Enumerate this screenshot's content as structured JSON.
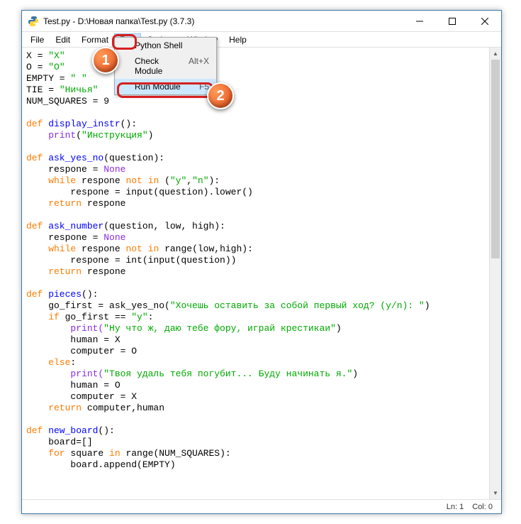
{
  "window": {
    "title": "Test.py - D:\\Новая папка\\Test.py (3.7.3)"
  },
  "menu": {
    "items": [
      "File",
      "Edit",
      "Format",
      "Run",
      "Options",
      "Window",
      "Help"
    ],
    "open_index": 3
  },
  "dropdown": {
    "items": [
      {
        "label": "Python Shell",
        "shortcut": ""
      },
      {
        "label": "Check Module",
        "shortcut": "Alt+X"
      },
      {
        "label": "Run Module",
        "shortcut": "F5"
      }
    ]
  },
  "badges": {
    "one": "1",
    "two": "2"
  },
  "status": {
    "line": "Ln: 1",
    "col": "Col: 0"
  },
  "code": {
    "l1a": "X = ",
    "l1b": "\"X\"",
    "l2a": "O = ",
    "l2b": "\"O\"",
    "l3a": "EMPTY = ",
    "l3b": "\" \"",
    "l4a": "TIE = ",
    "l4b": "\"Ничья\"",
    "l5a": "NUM_SQUARES = ",
    "l5b": "9",
    "l6": "",
    "l7a": "def",
    "l7b": " display_instr",
    "l7c": "():",
    "l8a": "    print",
    "l8b": "(",
    "l8c": "\"Инструкция\"",
    "l8d": ")",
    "l9": "",
    "l10a": "def",
    "l10b": " ask_yes_no",
    "l10c": "(question):",
    "l11a": "    respone = ",
    "l11b": "None",
    "l12a": "    while",
    "l12b": " respone ",
    "l12c": "not",
    "l12d": " ",
    "l12e": "in",
    "l12f": " (",
    "l12g": "\"y\"",
    "l12h": ",",
    "l12i": "\"n\"",
    "l12j": "):",
    "l13a": "        respone = input(question).lower()",
    "l14a": "    return",
    "l14b": " respone",
    "l15": "",
    "l16a": "def",
    "l16b": " ask_number",
    "l16c": "(question, low, high):",
    "l17a": "    respone = ",
    "l17b": "None",
    "l18a": "    while",
    "l18b": " respone ",
    "l18c": "not",
    "l18d": " ",
    "l18e": "in",
    "l18f": " range(low,high):",
    "l19a": "        respone = int(input(question))",
    "l20a": "    return",
    "l20b": " respone",
    "l21": "",
    "l22a": "def",
    "l22b": " pieces",
    "l22c": "():",
    "l23a": "    go_first = ask_yes_no(",
    "l23b": "\"Хочешь оставить за собой первый ход? (y/n): \"",
    "l23c": ")",
    "l24a": "    if",
    "l24b": " go_first == ",
    "l24c": "\"y\"",
    "l24d": ":",
    "l25a": "        print(",
    "l25b": "\"Ну что ж, даю тебе фору, играй крестикаи\"",
    "l25c": ")",
    "l26a": "        human = X",
    "l27a": "        computer = O",
    "l28a": "    else",
    "l28b": ":",
    "l29a": "        print(",
    "l29b": "\"Твоя удаль тебя погубит... Буду начинать я.\"",
    "l29c": ")",
    "l30a": "        human = O",
    "l31a": "        computer = X",
    "l32a": "    return",
    "l32b": " computer,human",
    "l33": "",
    "l34a": "def",
    "l34b": " new_board",
    "l34c": "():",
    "l35a": "    board=[]",
    "l36a": "    for",
    "l36b": " square ",
    "l36c": "in",
    "l36d": " range(NUM_SQUARES):",
    "l37a": "        board.append(EMPTY)"
  }
}
